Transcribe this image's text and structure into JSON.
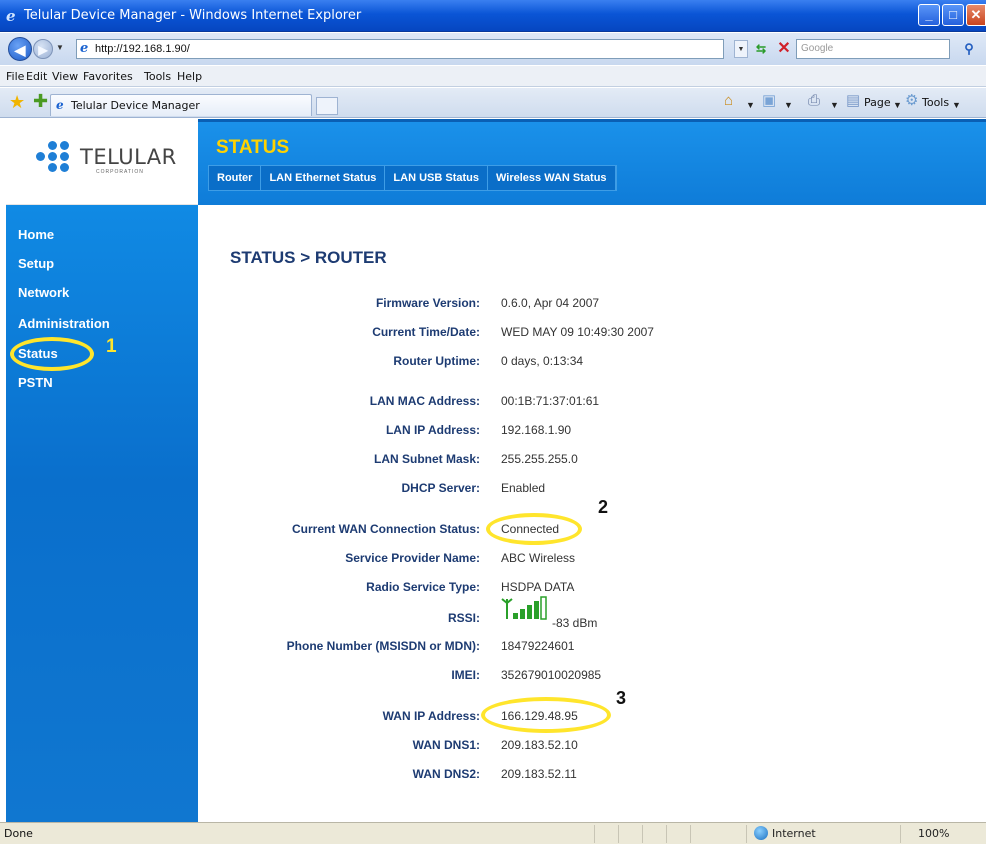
{
  "window": {
    "title": "Telular Device Manager - Windows Internet Explorer"
  },
  "address": {
    "url": "http://192.168.1.90/",
    "search_placeholder": "Google"
  },
  "menu": [
    "File",
    "Edit",
    "View",
    "Favorites",
    "Tools",
    "Help"
  ],
  "tab": {
    "label": "Telular Device Manager"
  },
  "toolbar": {
    "page_label": "Page",
    "tools_label": "Tools"
  },
  "brand": {
    "name": "TELULAR",
    "sub": "CORPORATION"
  },
  "header": {
    "title": "STATUS"
  },
  "subnav": [
    "Router",
    "LAN Ethernet Status",
    "LAN USB Status",
    "Wireless WAN Status"
  ],
  "sidebar": [
    "Home",
    "Setup",
    "Network",
    "Administration",
    "Status",
    "PSTN"
  ],
  "content": {
    "title": "STATUS > ROUTER",
    "rows": [
      {
        "label": "Firmware Version:",
        "value": "0.6.0, Apr 04 2007"
      },
      {
        "label": "Current Time/Date:",
        "value": "WED MAY 09 10:49:30 2007"
      },
      {
        "label": "Router Uptime:",
        "value": "0 days, 0:13:34"
      },
      {
        "label": "LAN MAC Address:",
        "value": "00:1B:71:37:01:61"
      },
      {
        "label": "LAN IP Address:",
        "value": "192.168.1.90"
      },
      {
        "label": "LAN Subnet Mask:",
        "value": "255.255.255.0"
      },
      {
        "label": "DHCP Server:",
        "value": "Enabled"
      },
      {
        "label": "Current WAN Connection Status:",
        "value": "Connected"
      },
      {
        "label": "Service Provider Name:",
        "value": "ABC Wireless"
      },
      {
        "label": "Radio Service Type:",
        "value": "HSDPA DATA"
      },
      {
        "label": "RSSI:",
        "value": "-83 dBm"
      },
      {
        "label": "Phone Number (MSISDN or MDN):",
        "value": "18479224601"
      },
      {
        "label": "IMEI:",
        "value": "352679010020985"
      },
      {
        "label": "WAN IP Address:",
        "value": "166.129.48.95"
      },
      {
        "label": "WAN DNS1:",
        "value": "209.183.52.10"
      },
      {
        "label": "WAN DNS2:",
        "value": "209.183.52.11"
      }
    ]
  },
  "annotations": [
    "1",
    "2",
    "3"
  ],
  "statusbar": {
    "left": "Done",
    "zone": "Internet",
    "zoom": "100%"
  }
}
